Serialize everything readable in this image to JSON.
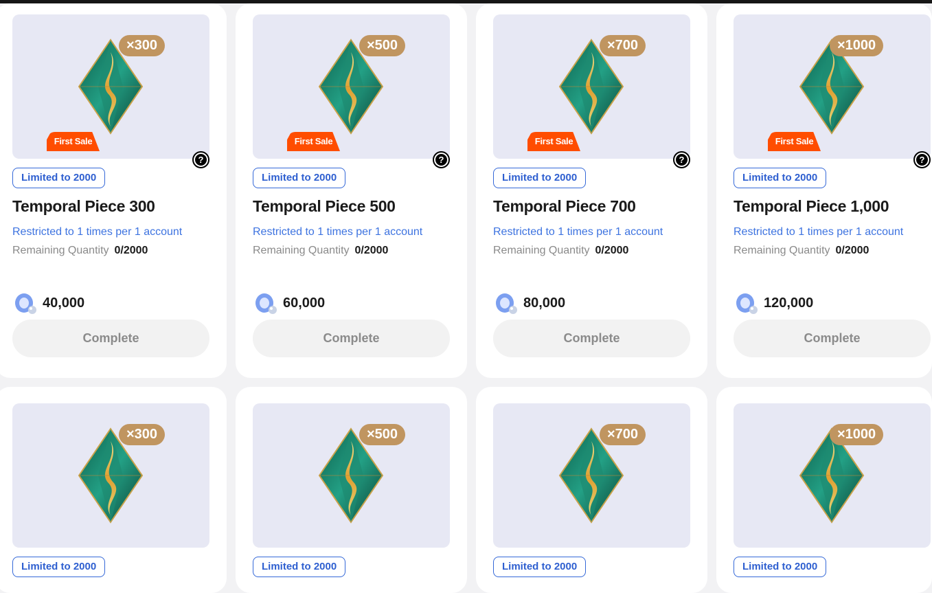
{
  "rows": [
    {
      "cards": [
        {
          "qty": "×300",
          "first_sale": "First Sale",
          "limit": "Limited to 2000",
          "title": "Temporal Piece 300",
          "restriction": "Restricted to 1 times per 1 account",
          "remaining_label": "Remaining Quantity",
          "remaining_value": "0/2000",
          "price": "40,000",
          "button": "Complete"
        },
        {
          "qty": "×500",
          "first_sale": "First Sale",
          "limit": "Limited to 2000",
          "title": "Temporal Piece 500",
          "restriction": "Restricted to 1 times per 1 account",
          "remaining_label": "Remaining Quantity",
          "remaining_value": "0/2000",
          "price": "60,000",
          "button": "Complete"
        },
        {
          "qty": "×700",
          "first_sale": "First Sale",
          "limit": "Limited to 2000",
          "title": "Temporal Piece 700",
          "restriction": "Restricted to 1 times per 1 account",
          "remaining_label": "Remaining Quantity",
          "remaining_value": "0/2000",
          "price": "80,000",
          "button": "Complete"
        },
        {
          "qty": "×1000",
          "first_sale": "First Sale",
          "limit": "Limited to 2000",
          "title": "Temporal Piece 1,000",
          "restriction": "Restricted to 1 times per 1 account",
          "remaining_label": "Remaining Quantity",
          "remaining_value": "0/2000",
          "price": "120,000",
          "button": "Complete"
        }
      ]
    },
    {
      "cards": [
        {
          "qty": "×300",
          "limit": "Limited to 2000"
        },
        {
          "qty": "×500",
          "limit": "Limited to 2000"
        },
        {
          "qty": "×700",
          "limit": "Limited to 2000"
        },
        {
          "qty": "×1000",
          "limit": "Limited to 2000"
        }
      ]
    }
  ],
  "icons": {
    "help": "question-circle-icon",
    "currency": "currency-orb-icon",
    "item": "temporal-crystal-icon"
  },
  "colors": {
    "limit_text": "#2e5fd0",
    "first_sale_bg": "#ff4d00",
    "qty_badge_bg": "#c09560",
    "restriction_text": "#3d73e0",
    "thumb_bg": "#e7e8f4"
  }
}
